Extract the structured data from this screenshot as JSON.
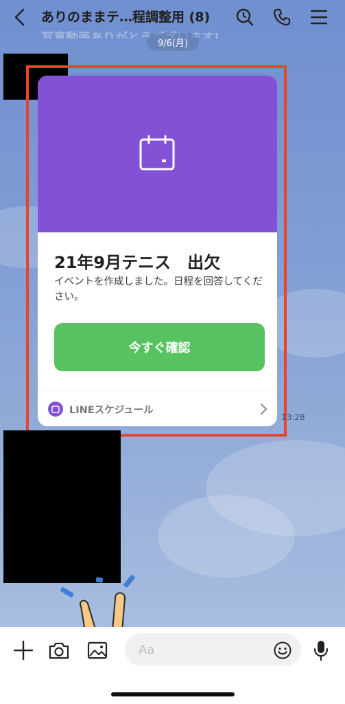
{
  "header": {
    "title": "ありのままテ…程調整用 (8)",
    "faded_message": "写真動画ありがとうございます!",
    "icons": [
      "back-icon",
      "search-icon",
      "phone-icon",
      "menu-icon"
    ]
  },
  "date_label": "9/6(月)",
  "event_card": {
    "title": "21年9月テニス　出欠",
    "description": "イベントを作成しました。日程を回答してください。",
    "button_label": "今すぐ確認",
    "app_label": "LINEスケジュール",
    "accent_color": "#8351d6",
    "button_color": "#57c25f",
    "icons": [
      "calendar-icon",
      "chevron-right-icon"
    ]
  },
  "timestamp": "13:28",
  "composer": {
    "placeholder": "Aa",
    "icons": [
      "plus-icon",
      "camera-icon",
      "image-icon",
      "emoji-icon",
      "microphone-icon"
    ]
  },
  "highlight_color": "#e8432b"
}
